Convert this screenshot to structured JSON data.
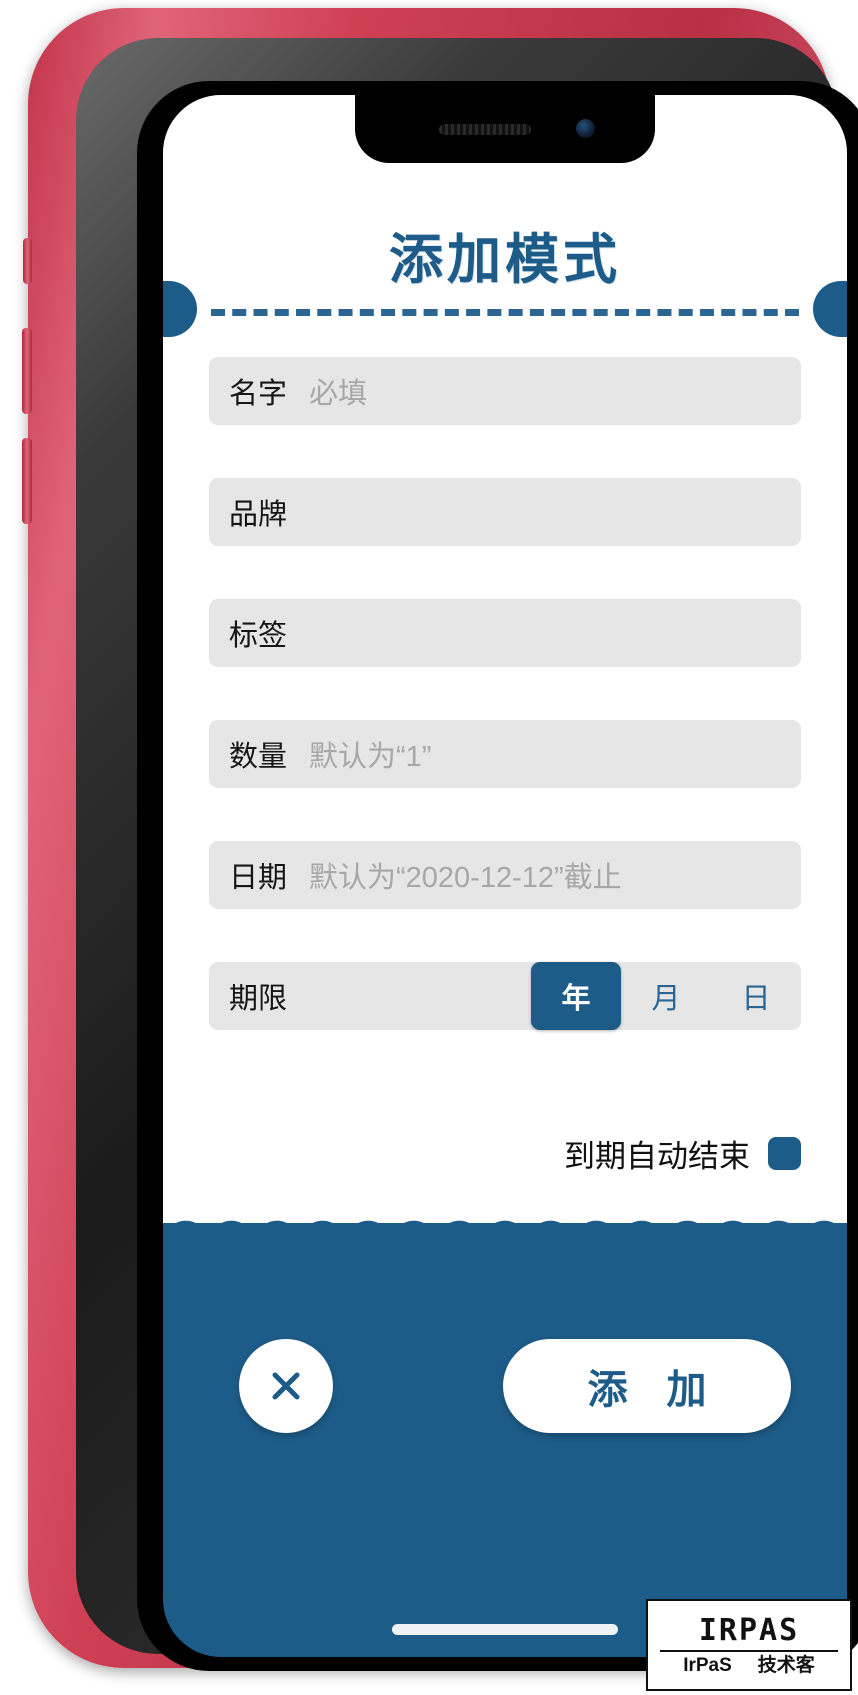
{
  "app": {
    "title": "添加模式",
    "accent_color": "#1d5c88",
    "card_background": "#ffffff",
    "field_background": "#e6e6e6"
  },
  "form": {
    "fields": [
      {
        "label": "名字",
        "placeholder": "必填",
        "value": ""
      },
      {
        "label": "品牌",
        "placeholder": "",
        "value": ""
      },
      {
        "label": "标签",
        "placeholder": "",
        "value": ""
      },
      {
        "label": "数量",
        "placeholder": "默认为“1”",
        "value": ""
      },
      {
        "label": "日期",
        "placeholder": "默认为“2020-12-12”截止",
        "value": ""
      }
    ],
    "term": {
      "label": "期限",
      "options": [
        "年",
        "月",
        "日"
      ],
      "selected": "年"
    },
    "auto_end": {
      "label": "到期自动结束",
      "checked": true
    }
  },
  "actions": {
    "close_label": "×",
    "close_icon": "close-icon",
    "submit_label": "添 加"
  },
  "watermark": {
    "logo": "IRPAS",
    "name": "IrPaS",
    "tag": "技术客"
  }
}
